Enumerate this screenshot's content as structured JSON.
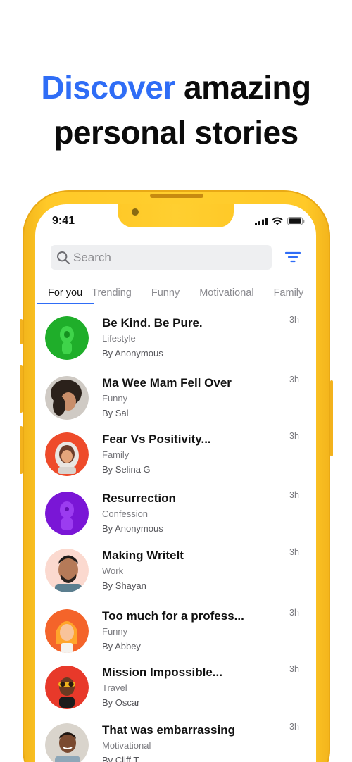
{
  "headline": {
    "accent": "Discover",
    "rest_line1": " amazing",
    "line2": "personal stories"
  },
  "status_bar": {
    "time": "9:41"
  },
  "search": {
    "placeholder": "Search"
  },
  "tabs": [
    {
      "label": "For you"
    },
    {
      "label": "Trending"
    },
    {
      "label": "Funny"
    },
    {
      "label": "Motivational"
    },
    {
      "label": "Family"
    }
  ],
  "stories": [
    {
      "title": "Be Kind. Be Pure.",
      "category": "Lifestyle",
      "author": "By Anonymous",
      "time": "3h"
    },
    {
      "title": "Ma Wee Mam Fell Over",
      "category": "Funny",
      "author": "By Sal",
      "time": "3h"
    },
    {
      "title": "Fear Vs Positivity...",
      "category": "Family",
      "author": "By Selina G",
      "time": "3h"
    },
    {
      "title": "Resurrection",
      "category": "Confession",
      "author": "By Anonymous",
      "time": "3h"
    },
    {
      "title": "Making WriteIt",
      "category": "Work",
      "author": "By Shayan",
      "time": "3h"
    },
    {
      "title": "Too much for a profess...",
      "category": "Funny",
      "author": "By Abbey",
      "time": "3h"
    },
    {
      "title": "Mission Impossible...",
      "category": "Travel",
      "author": "By Oscar",
      "time": "3h"
    },
    {
      "title": "That was embarrassing",
      "category": "Motivational",
      "author": "By Cliff T",
      "time": "3h"
    }
  ],
  "colors": {
    "accent": "#2f6df6",
    "phone_frame": "#ffc928",
    "tab_indicator": "#2f6df6"
  }
}
